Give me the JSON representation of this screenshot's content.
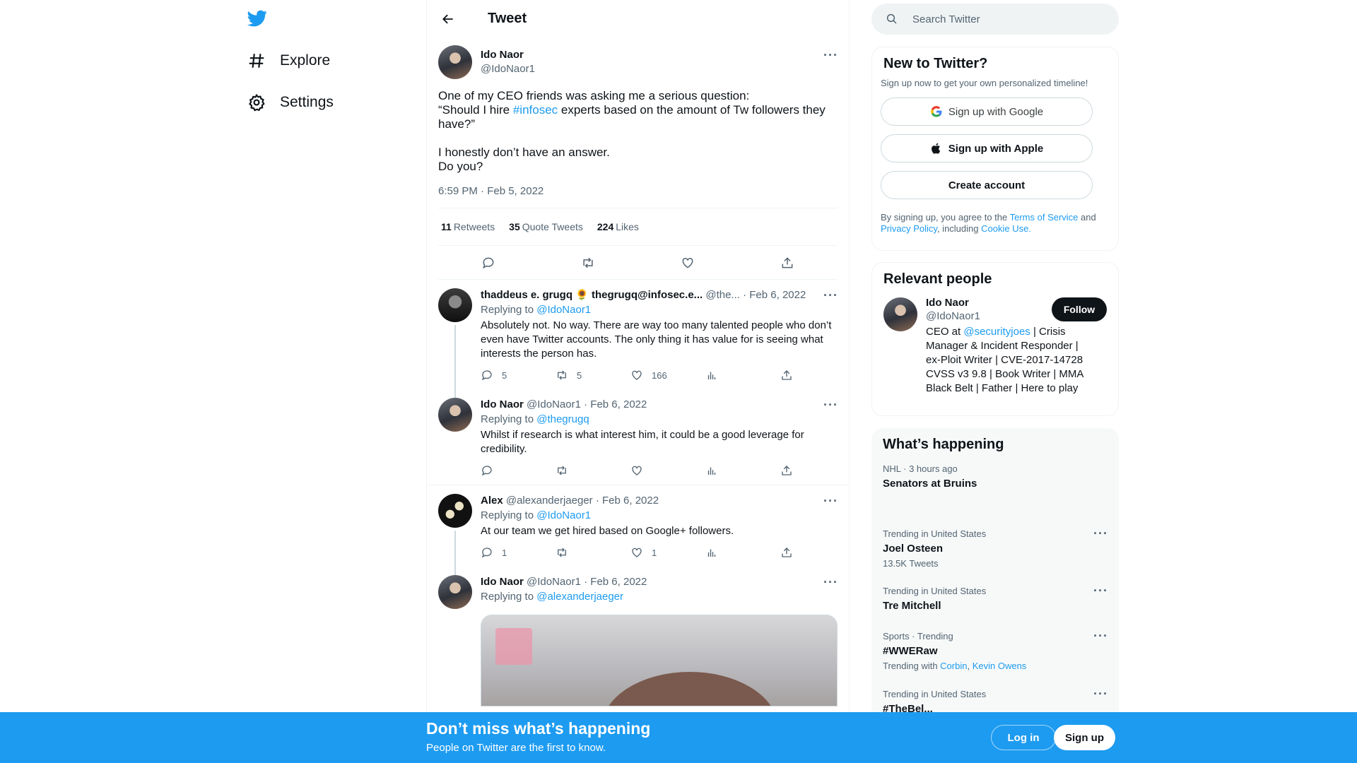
{
  "nav": {
    "logo_icon": "twitter-bird-icon",
    "items": [
      {
        "label": "Explore",
        "icon": "hashtag-icon"
      },
      {
        "label": "Settings",
        "icon": "gear-icon"
      }
    ]
  },
  "header": {
    "title": "Tweet"
  },
  "main_tweet": {
    "display_name": "Ido Naor",
    "handle": "@IdoNaor1",
    "text_part1": "One of my CEO friends was asking me a serious question:\n“Should I hire ",
    "hashtag": "#infosec",
    "text_part2": " experts based on the amount of Tw followers they have?”\n\nI honestly don’t have an answer.\nDo you?",
    "timestamp": "6:59 PM · Feb 5, 2022",
    "stats": {
      "retweets": "11",
      "retweets_label": "Retweets",
      "quotes": "35",
      "quotes_label": "Quote Tweets",
      "likes": "224",
      "likes_label": "Likes"
    }
  },
  "replies": [
    {
      "display_name": "thaddeus e. grugq 🌻 thegrugq@infosec.e...",
      "handle": "@the...",
      "date": "· Feb 6, 2022",
      "replying_prefix": "Replying to",
      "replying_to": "@IdoNaor1",
      "text": "Absolutely not. No way. There are way too many talented people who don’t even have Twitter accounts. The only thing it has value for is seeing what interests the person has.",
      "reply_count": "5",
      "retweet_count": "5",
      "like_count": "166"
    },
    {
      "display_name": "Ido Naor",
      "handle": "@IdoNaor1",
      "date": "· Feb 6, 2022",
      "replying_prefix": "Replying to",
      "replying_to": "@thegrugq",
      "text": "Whilst if research is what interest him, it could be a good leverage for credibility."
    },
    {
      "display_name": "Alex",
      "handle": "@alexanderjaeger",
      "date": "· Feb 6, 2022",
      "replying_prefix": "Replying to",
      "replying_to": "@IdoNaor1",
      "text": "At our team we get hired based on Google+ followers.",
      "reply_count": "1",
      "like_count": "1"
    },
    {
      "display_name": "Ido Naor",
      "handle": "@IdoNaor1",
      "date": "· Feb 6, 2022",
      "replying_prefix": "Replying to",
      "replying_to": "@alexanderjaeger"
    }
  ],
  "search": {
    "placeholder": "Search Twitter"
  },
  "signup_card": {
    "title": "New to Twitter?",
    "subtitle": "Sign up now to get your own personalized timeline!",
    "google_label": "Sign up with Google",
    "apple_label": "Sign up with Apple",
    "create_label": "Create account",
    "legal_prefix": "By signing up, you agree to the ",
    "terms": "Terms of Service",
    "and": " and ",
    "privacy": "Privacy Policy",
    "including": ", including ",
    "cookie": "Cookie Use."
  },
  "people_card": {
    "title": "Relevant people",
    "display_name": "Ido Naor",
    "handle": "@IdoNaor1",
    "follow_label": "Follow",
    "bio_prefix": "CEO at ",
    "bio_mention": "@securityjoes",
    "bio_rest": " | Crisis Manager & Incident Responder | ex-Ploit Writer | CVE-2017-14728 CVSS v3 9.8 | Book Writer | MMA Black Belt | Father | Here to play"
  },
  "trends_card": {
    "title": "What’s happening",
    "trends": [
      {
        "context": "NHL · 3 hours ago",
        "name": "Senators at Bruins"
      },
      {
        "context": "Trending in United States",
        "name": "Joel Osteen",
        "meta": "13.5K Tweets"
      },
      {
        "context": "Trending in United States",
        "name": "Tre Mitchell"
      },
      {
        "context": "Sports · Trending",
        "name": "#WWERaw",
        "meta_prefix": "Trending with ",
        "link1": "Corbin",
        "link2": "Kevin Owens"
      },
      {
        "context": "Trending in United States",
        "name": "#TheBel..."
      }
    ]
  },
  "bottom_bar": {
    "title": "Don’t miss what’s happening",
    "subtitle": "People on Twitter are the first to know.",
    "login_label": "Log in",
    "signup_label": "Sign up"
  },
  "colors": {
    "accent": "#1d9bf0",
    "text": "#0f1419",
    "secondary": "#536471"
  }
}
